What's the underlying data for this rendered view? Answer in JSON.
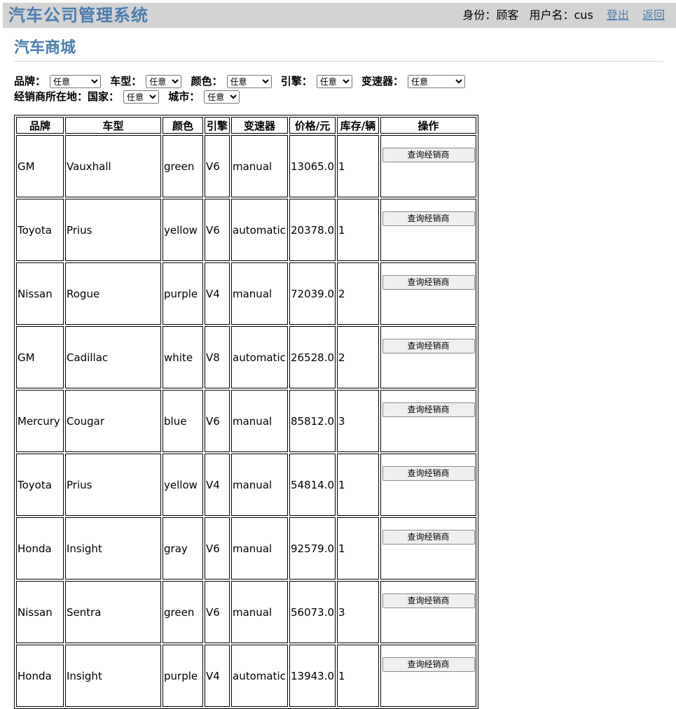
{
  "app": {
    "title": "汽车公司管理系统"
  },
  "user": {
    "identity": "身份：顾客",
    "username": "用户名：cus",
    "logout_label": "登出",
    "back_label": "返回"
  },
  "page": {
    "heading": "汽车商城"
  },
  "filters": {
    "brand_label": "品牌：",
    "brand_value": "任意",
    "model_label": "车型：",
    "model_value": "任意",
    "color_label": "颜色：",
    "color_value": "任意",
    "engine_label": "引擎：",
    "engine_value": "任意",
    "transmission_label": "变速器：",
    "transmission_value": "任意",
    "dealer_location_label": "经销商所在地：",
    "country_label": "国家：",
    "country_value": "任意",
    "city_label": "城市：",
    "city_value": "任意"
  },
  "table": {
    "headers": [
      "品牌",
      "车型",
      "颜色",
      "引擎",
      "变速器",
      "价格/元",
      "库存/辆",
      "操作"
    ],
    "action_label": "查询经销商",
    "rows": [
      [
        "GM",
        "Vauxhall",
        "green",
        "V6",
        "manual",
        "13065.0",
        "1"
      ],
      [
        "Toyota",
        "Prius",
        "yellow",
        "V6",
        "automatic",
        "20378.0",
        "1"
      ],
      [
        "Nissan",
        "Rogue",
        "purple",
        "V4",
        "manual",
        "72039.0",
        "2"
      ],
      [
        "GM",
        "Cadillac",
        "white",
        "V8",
        "automatic",
        "26528.0",
        "2"
      ],
      [
        "Mercury",
        "Cougar",
        "blue",
        "V6",
        "manual",
        "85812.0",
        "3"
      ],
      [
        "Toyota",
        "Prius",
        "yellow",
        "V4",
        "manual",
        "54814.0",
        "1"
      ],
      [
        "Honda",
        "Insight",
        "gray",
        "V6",
        "manual",
        "92579.0",
        "1"
      ],
      [
        "Nissan",
        "Sentra",
        "green",
        "V6",
        "manual",
        "56073.0",
        "3"
      ],
      [
        "Honda",
        "Insight",
        "purple",
        "V4",
        "automatic",
        "13943.0",
        "1"
      ]
    ]
  },
  "colors": {
    "accent": "#4a7eb0",
    "topbar_bg": "#d3d3d3"
  }
}
